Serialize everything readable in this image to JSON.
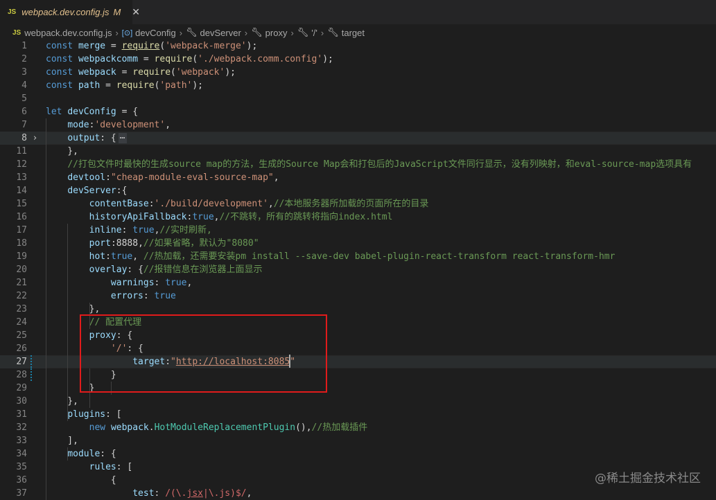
{
  "tab": {
    "badge": "JS",
    "filename": "webpack.dev.config.js",
    "modified": "M",
    "close": "✕"
  },
  "breadcrumb": {
    "badge": "JS",
    "file": "webpack.dev.config.js",
    "items": [
      "devConfig",
      "devServer",
      "proxy",
      "'/'",
      "target"
    ],
    "separator": "›"
  },
  "lines": [
    {
      "n": "1",
      "tokens": [
        [
          "kw",
          "const "
        ],
        [
          "var",
          "merge"
        ],
        [
          "p",
          " = "
        ],
        [
          "fn ul",
          "require"
        ],
        [
          "p",
          "("
        ],
        [
          "str",
          "'webpack-merge'"
        ],
        [
          "p",
          ");"
        ]
      ]
    },
    {
      "n": "2",
      "tokens": [
        [
          "kw",
          "const "
        ],
        [
          "var",
          "webpackcomm"
        ],
        [
          "p",
          " = "
        ],
        [
          "fn",
          "require"
        ],
        [
          "p",
          "("
        ],
        [
          "str",
          "'./webpack.comm.config'"
        ],
        [
          "p",
          ");"
        ]
      ]
    },
    {
      "n": "3",
      "tokens": [
        [
          "kw",
          "const "
        ],
        [
          "var",
          "webpack"
        ],
        [
          "p",
          " = "
        ],
        [
          "fn",
          "require"
        ],
        [
          "p",
          "("
        ],
        [
          "str",
          "'webpack'"
        ],
        [
          "p",
          ");"
        ]
      ]
    },
    {
      "n": "4",
      "tokens": [
        [
          "kw",
          "const "
        ],
        [
          "var",
          "path"
        ],
        [
          "p",
          " = "
        ],
        [
          "fn",
          "require"
        ],
        [
          "p",
          "("
        ],
        [
          "str",
          "'path'"
        ],
        [
          "p",
          ");"
        ]
      ]
    },
    {
      "n": "5",
      "tokens": []
    },
    {
      "n": "6",
      "tokens": [
        [
          "kw",
          "let "
        ],
        [
          "var",
          "devConfig"
        ],
        [
          "p",
          " = {"
        ]
      ]
    },
    {
      "n": "7",
      "tokens": [
        [
          "p",
          "    "
        ],
        [
          "var",
          "mode"
        ],
        [
          "p",
          ":"
        ],
        [
          "str",
          "'development'"
        ],
        [
          "p",
          ","
        ]
      ]
    },
    {
      "n": "8",
      "tokens": [
        [
          "p",
          "    "
        ],
        [
          "var",
          "output"
        ],
        [
          "p",
          ": {"
        ],
        [
          "ell",
          "⋯"
        ]
      ],
      "fold": "›",
      "current": true
    },
    {
      "n": "11",
      "tokens": [
        [
          "p",
          "    },"
        ]
      ]
    },
    {
      "n": "12",
      "tokens": [
        [
          "p",
          "    "
        ],
        [
          "cm",
          "//打包文件时最快的生成source map的方法，生成的Source Map会和打包后的JavaScript文件同行显示，没有列映射，和eval-source-map选项具有"
        ]
      ]
    },
    {
      "n": "13",
      "tokens": [
        [
          "p",
          "    "
        ],
        [
          "var",
          "devtool"
        ],
        [
          "p",
          ":"
        ],
        [
          "str",
          "\"cheap-module-eval-source-map\""
        ],
        [
          "p",
          ","
        ]
      ]
    },
    {
      "n": "14",
      "tokens": [
        [
          "p",
          "    "
        ],
        [
          "var",
          "devServer"
        ],
        [
          "p",
          ":{"
        ]
      ]
    },
    {
      "n": "15",
      "tokens": [
        [
          "p",
          "        "
        ],
        [
          "var",
          "contentBase"
        ],
        [
          "p",
          ":"
        ],
        [
          "str",
          "'./build/development'"
        ],
        [
          "p",
          ","
        ],
        [
          "cm",
          "//本地服务器所加载的页面所在的目录"
        ]
      ]
    },
    {
      "n": "16",
      "tokens": [
        [
          "p",
          "        "
        ],
        [
          "var",
          "historyApiFallback"
        ],
        [
          "p",
          ":"
        ],
        [
          "kw",
          "true"
        ],
        [
          "p",
          ","
        ],
        [
          "cm",
          "//不跳转，所有的跳转将指向index.html"
        ]
      ]
    },
    {
      "n": "17",
      "tokens": [
        [
          "p",
          "        "
        ],
        [
          "var",
          "inline"
        ],
        [
          "p",
          ": "
        ],
        [
          "kw",
          "true"
        ],
        [
          "p",
          ","
        ],
        [
          "cm",
          "//实时刷新,"
        ]
      ]
    },
    {
      "n": "18",
      "tokens": [
        [
          "p",
          "        "
        ],
        [
          "var",
          "port"
        ],
        [
          "p",
          ":8888,"
        ],
        [
          "cm",
          "//如果省略，默认为\"8080\""
        ]
      ]
    },
    {
      "n": "19",
      "tokens": [
        [
          "p",
          "        "
        ],
        [
          "var",
          "hot"
        ],
        [
          "p",
          ":"
        ],
        [
          "kw",
          "true"
        ],
        [
          "p",
          ", "
        ],
        [
          "cm",
          "//热加载，还需要安装pm install --save-dev babel-plugin-react-transform react-transform-hmr"
        ]
      ]
    },
    {
      "n": "20",
      "tokens": [
        [
          "p",
          "        "
        ],
        [
          "var",
          "overlay"
        ],
        [
          "p",
          ": {"
        ],
        [
          "cm",
          "//报错信息在浏览器上面显示"
        ]
      ]
    },
    {
      "n": "21",
      "tokens": [
        [
          "p",
          "            "
        ],
        [
          "var",
          "warnings"
        ],
        [
          "p",
          ": "
        ],
        [
          "kw",
          "true"
        ],
        [
          "p",
          ","
        ]
      ]
    },
    {
      "n": "22",
      "tokens": [
        [
          "p",
          "            "
        ],
        [
          "var",
          "errors"
        ],
        [
          "p",
          ": "
        ],
        [
          "kw",
          "true"
        ]
      ]
    },
    {
      "n": "23",
      "tokens": [
        [
          "p",
          "        },"
        ]
      ]
    },
    {
      "n": "24",
      "tokens": [
        [
          "p",
          "        "
        ],
        [
          "cm",
          "// 配置代理"
        ]
      ]
    },
    {
      "n": "25",
      "tokens": [
        [
          "p",
          "        "
        ],
        [
          "var",
          "proxy"
        ],
        [
          "p",
          ": {"
        ]
      ]
    },
    {
      "n": "26",
      "tokens": [
        [
          "p",
          "            "
        ],
        [
          "str",
          "'/'"
        ],
        [
          "p",
          ": {"
        ]
      ]
    },
    {
      "n": "27",
      "tokens": [
        [
          "p",
          "                "
        ],
        [
          "var",
          "target"
        ],
        [
          "p",
          ":"
        ],
        [
          "str",
          "\""
        ],
        [
          "str ul",
          "http://localhost:8085"
        ],
        [
          "str",
          "\""
        ]
      ],
      "current": true,
      "modified": true
    },
    {
      "n": "28",
      "tokens": [
        [
          "p",
          "            }"
        ]
      ],
      "modified": true
    },
    {
      "n": "29",
      "tokens": [
        [
          "p",
          "        }"
        ]
      ]
    },
    {
      "n": "30",
      "tokens": [
        [
          "p",
          "    },"
        ]
      ]
    },
    {
      "n": "31",
      "tokens": [
        [
          "p",
          "    "
        ],
        [
          "var",
          "plugins"
        ],
        [
          "p",
          ": ["
        ]
      ]
    },
    {
      "n": "32",
      "tokens": [
        [
          "p",
          "        "
        ],
        [
          "kw",
          "new "
        ],
        [
          "var",
          "webpack"
        ],
        [
          "p",
          "."
        ],
        [
          "cls",
          "HotModuleReplacementPlugin"
        ],
        [
          "p",
          "(),"
        ],
        [
          "cm",
          "//热加载插件"
        ]
      ]
    },
    {
      "n": "33",
      "tokens": [
        [
          "p",
          "    ],"
        ]
      ]
    },
    {
      "n": "34",
      "tokens": [
        [
          "p",
          "    "
        ],
        [
          "var",
          "module"
        ],
        [
          "p",
          ": {"
        ]
      ]
    },
    {
      "n": "35",
      "tokens": [
        [
          "p",
          "        "
        ],
        [
          "var",
          "rules"
        ],
        [
          "p",
          ": ["
        ]
      ]
    },
    {
      "n": "36",
      "tokens": [
        [
          "p",
          "            {"
        ]
      ]
    },
    {
      "n": "37",
      "tokens": [
        [
          "p",
          "                "
        ],
        [
          "var",
          "test"
        ],
        [
          "p",
          ": "
        ],
        [
          "rx",
          "/(\\."
        ],
        [
          "rx ul",
          "jsx"
        ],
        [
          "rx",
          "|\\.js)$/"
        ],
        [
          "p",
          ","
        ]
      ]
    }
  ],
  "watermark": "@稀土掘金技术社区"
}
